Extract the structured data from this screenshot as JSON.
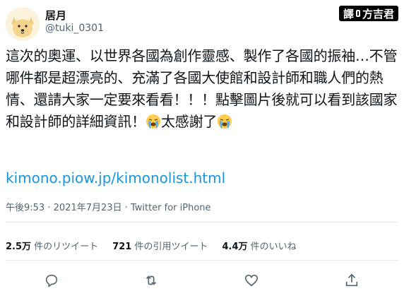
{
  "header": {
    "display_name": "居月",
    "handle": "@tuki_0301"
  },
  "watermark": {
    "left": "譯",
    "right": "方吉君"
  },
  "tweet": {
    "text_before_emoji": "這次的奧運、以世界各國為創作靈感、製作了各國的振袖…不管哪件都是超漂亮的、充滿了各國大使館和設計師和職人們的熱情、還請大家一定要來看看！！！點擊圖片後就可以看到該國家和設計師的詳細資訊！",
    "text_middle": "太感謝了",
    "emoji_icon": "loudly-crying-face-icon",
    "link": "kimono.piow.jp/kimonolist.html"
  },
  "meta": {
    "time": "午後9:53",
    "sep": "·",
    "date": "2021年7月23日",
    "source": "Twitter for iPhone"
  },
  "stats": {
    "retweets_count": "2.5万",
    "retweets_label": "件のリツイート",
    "quotes_count": "721",
    "quotes_label": "件の引用ツイート",
    "likes_count": "4.4万",
    "likes_label": "件のいいね"
  },
  "actions": [
    "reply-icon",
    "retweet-icon",
    "like-icon",
    "share-icon"
  ]
}
